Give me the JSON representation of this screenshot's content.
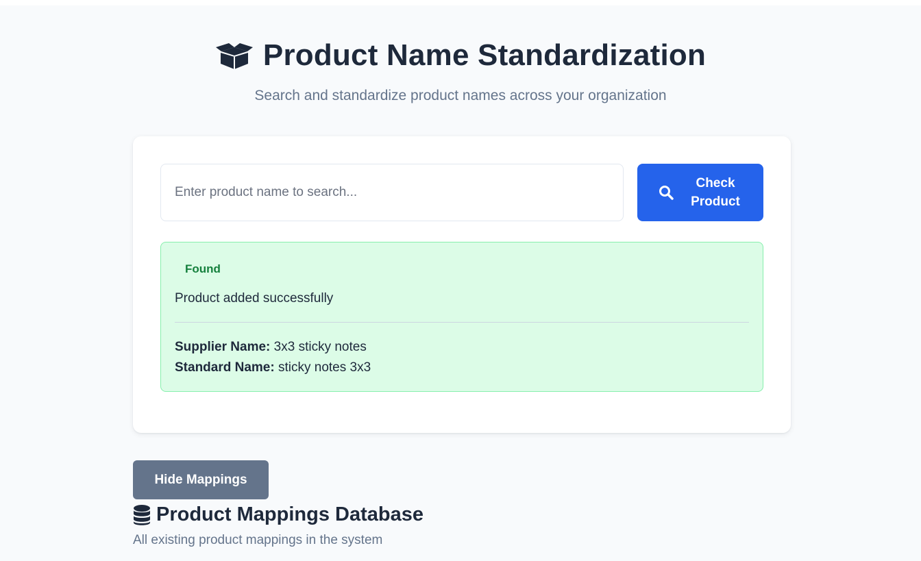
{
  "header": {
    "icon": "box-open-icon",
    "title": "Product Name Standardization",
    "subtitle": "Search and standardize product names across your organization"
  },
  "search": {
    "value": "",
    "placeholder": "Enter product name to search...",
    "button_label": "Check Product",
    "button_icon": "search-icon",
    "button_color": "#2563eb"
  },
  "result": {
    "badge": "Found",
    "message": "Product added successfully",
    "supplier_label": "Supplier Name:",
    "supplier_value": "3x3 sticky notes",
    "standard_label": "Standard Name:",
    "standard_value": "sticky notes 3x3",
    "status_color": "#15803d"
  },
  "mappings": {
    "toggle_label": "Hide Mappings",
    "icon": "database-icon",
    "title": "Product Mappings Database",
    "subtitle": "All existing product mappings in the system"
  }
}
